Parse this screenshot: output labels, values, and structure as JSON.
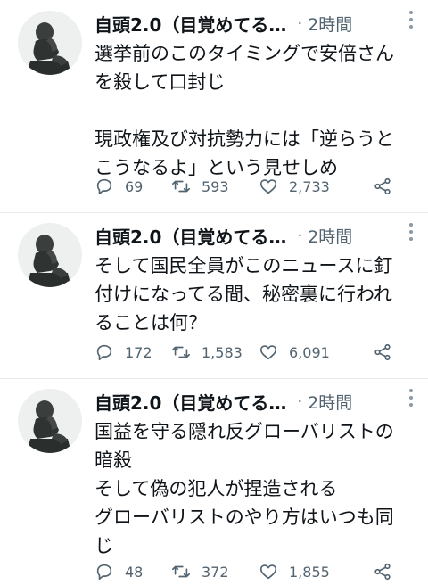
{
  "tweets": [
    {
      "name": "自頭2.0（目覚めてる…",
      "separator": "·",
      "time": "2時間",
      "text": "選挙前のこのタイミングで安倍さん\nを殺して口封じ\n\n現政権及び対抗勢力には「逆らうと\nこうなるよ」という見せしめ",
      "replies": "69",
      "retweets": "593",
      "likes": "2,733"
    },
    {
      "name": "自頭2.0（目覚めてる…",
      "separator": "·",
      "time": "2時間",
      "text": "そして国民全員がこのニュースに釘\n付けになってる間、秘密裏に行われ\nることは何？",
      "replies": "172",
      "retweets": "1,583",
      "likes": "6,091"
    },
    {
      "name": "自頭2.0（目覚めてる…",
      "separator": "·",
      "time": "2時間",
      "text": "国益を守る隠れ反グローバリストの\n暗殺\nそして偽の犯人が捏造される\nグローバリストのやり方はいつも同\nじ",
      "replies": "48",
      "retweets": "372",
      "likes": "1,855"
    }
  ],
  "icons": {
    "reply": "reply-icon",
    "retweet": "retweet-icon",
    "like": "heart-icon",
    "share": "share-icon",
    "more": "more-icon",
    "avatar": "thinker-statue-avatar"
  },
  "colors": {
    "text": "#0f1419",
    "secondary": "#536471",
    "divider": "#e6ecf0",
    "background": "#ffffff"
  }
}
